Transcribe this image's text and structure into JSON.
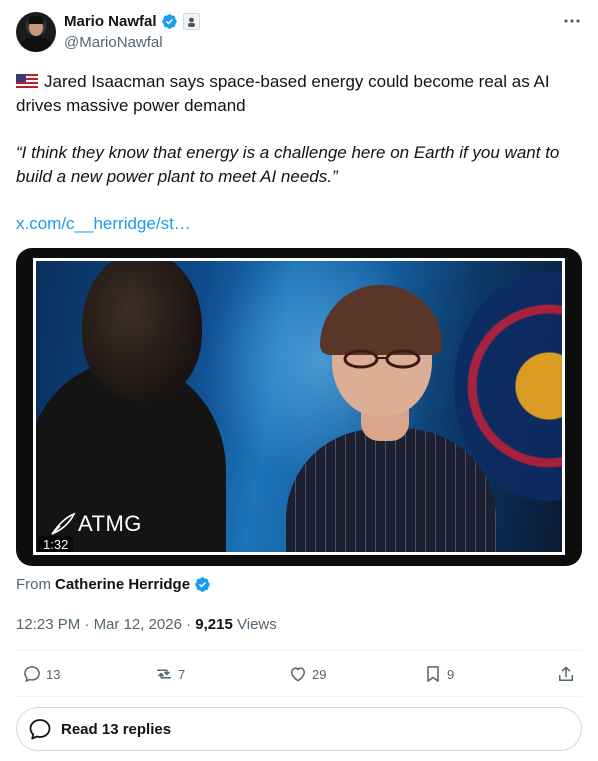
{
  "author": {
    "display_name": "Mario Nawfal",
    "handle": "@MarioNawfal",
    "verified": true
  },
  "tweet": {
    "flag_icon": "us-flag-icon",
    "headline": "Jared Isaacman says space-based energy could become real as AI drives massive power demand",
    "quote": "“I think they know that energy is a challenge here on Earth if you want to build a new power plant to meet AI needs.”",
    "link_text": "x.com/c__herridge/st…"
  },
  "media": {
    "watermark": "ATMG",
    "duration": "1:32"
  },
  "source": {
    "from_label": "From",
    "from_name": "Catherine Herridge"
  },
  "meta": {
    "time": "12:23 PM",
    "separator": "·",
    "date": "Mar 12, 2026",
    "views_count": "9,215",
    "views_label": "Views"
  },
  "actions": {
    "replies": "13",
    "reposts": "7",
    "likes": "29",
    "bookmarks": "9"
  },
  "read_replies_label": "Read 13 replies",
  "colors": {
    "accent": "#1d9bf0",
    "text": "#0f1419",
    "secondary": "#536471"
  }
}
